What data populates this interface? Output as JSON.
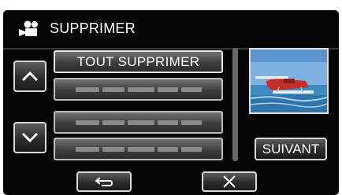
{
  "header": {
    "title": "SUPPRIMER",
    "icon": "movie-camera-icon"
  },
  "list": {
    "items": [
      {
        "label": "TOUT SUPPRIMER"
      },
      {
        "label": ""
      },
      {
        "label": ""
      },
      {
        "label": ""
      }
    ]
  },
  "side": {
    "next_label": "SUIVANT",
    "thumbnail": "seaplane-preview-image"
  },
  "icons": {
    "up": "chevron-up-icon",
    "down": "chevron-down-icon",
    "back": "return-arrow-icon",
    "close": "close-icon"
  }
}
